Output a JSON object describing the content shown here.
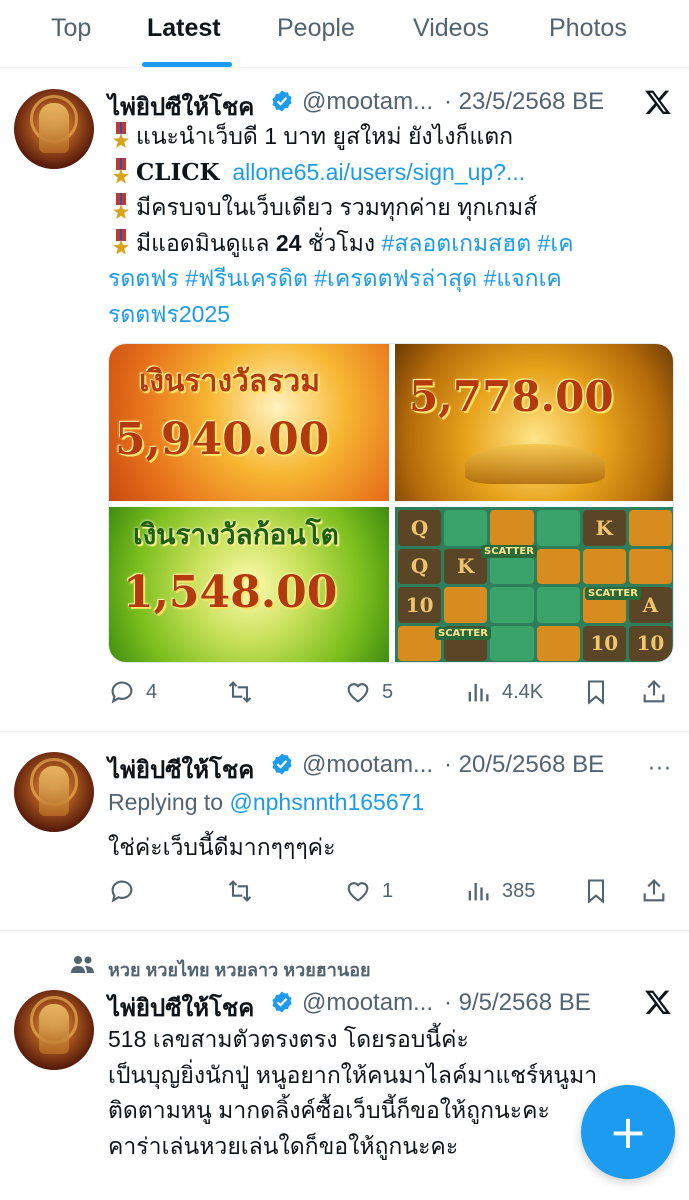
{
  "tabs": [
    "Top",
    "Latest",
    "People",
    "Videos",
    "Photos"
  ],
  "active_tab": "Latest",
  "posts": [
    {
      "name": "ไพ่ยิปซีให้โชค",
      "handle": "@mootam...",
      "date": "· 23/5/2568 BE",
      "lines": [
        {
          "text": "แนะนำเว็บดี 1 บาท ยูสใหม่ ยังไงก็แตก"
        },
        {
          "text": "CLICK",
          "link": "allone65.ai/users/sign_up?..."
        },
        {
          "text": "มีครบจบในเว็บเดียว รวมทุกค่าย ทุกเกมส์"
        },
        {
          "text": "มีแอดมินดูแล ",
          "bold": "24",
          "text2": " ชั่วโมง ",
          "link": "#สลอตเกมสฮต #เค"
        }
      ],
      "hashtag_lines": [
        "รดตฟร #ฟรีนเครดิต  #เครดตฟรล่าสุด #แจกเค",
        "รดตฟร2025"
      ],
      "images": [
        {
          "title": "เงินรางวัลรวม",
          "amount": "5,940.00"
        },
        {
          "title": "",
          "amount": "5,778.00"
        },
        {
          "title": "เงินรางวัลก้อนโต",
          "amount": "1,548.00"
        },
        {
          "title": "",
          "amount": ""
        }
      ],
      "slot_symbols": [
        "Q",
        "K",
        "",
        "",
        "K",
        "",
        "10",
        "",
        "",
        "",
        "",
        "A",
        "",
        "",
        "",
        "",
        "10",
        "",
        "SCATTER",
        "SCATTER",
        "SCATTER"
      ],
      "stats": {
        "replies": "4",
        "retweets": "",
        "likes": "5",
        "views": "4.4K"
      }
    },
    {
      "name": "ไพ่ยิปซีให้โชค",
      "handle": "@mootam...",
      "date": "· 20/5/2568 BE",
      "replying_label": "Replying to",
      "replying_to": "@nphsnnth165671",
      "text": "ใช่ค่ะเว็บนี้ดีมากๆๆๆค่ะ",
      "more": "···",
      "stats": {
        "replies": "",
        "retweets": "",
        "likes": "1",
        "views": "385"
      }
    },
    {
      "social_context": "หวย หวยไทย หวยลาว หวยฮานอย",
      "name": "ไพ่ยิปซีให้โชค",
      "handle": "@mootam...",
      "date": "· 9/5/2568 BE",
      "lines": [
        "518 เลขสามตัวตรงตรง โดยรอบนี้ค่ะ",
        "เป็นบุญยิ่งนักปู่ หนูอยากให้คนมาไลค์มาแชร์หนูมา",
        "ติดตามหนู มากดลิ้งค์ซื้อเว็บนี้ก็ขอให้ถูกนะคะ",
        "คาร่าเล่นหวยเล่นใดก็ขอให้ถูกนะคะ"
      ]
    }
  ],
  "colors": {
    "accent": "#1d9bf0",
    "text": "#0f1419",
    "muted": "#536471"
  },
  "icons": [
    "verified-badge-icon",
    "x-logo-icon",
    "reply-icon",
    "retweet-icon",
    "like-icon",
    "views-icon",
    "bookmark-icon",
    "share-icon",
    "people-icon",
    "plus-icon"
  ]
}
